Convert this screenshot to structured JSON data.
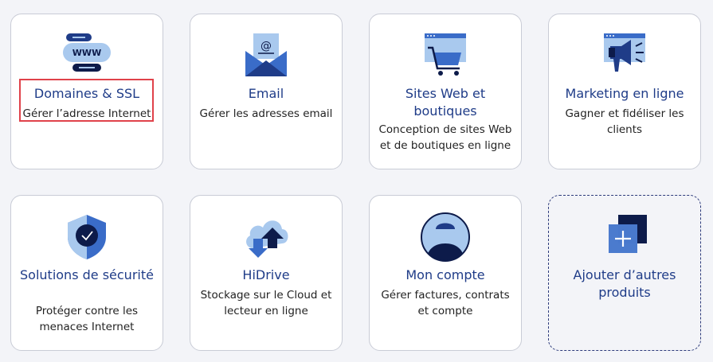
{
  "cards": [
    {
      "title": "Domaines & SSL",
      "desc": "Gérer l’adresse Internet",
      "icon": "www-icon"
    },
    {
      "title": "Email",
      "desc": "Gérer les adresses email",
      "icon": "envelope-icon"
    },
    {
      "title": "Sites Web et boutiques",
      "desc": "Conception de sites Web et de boutiques en ligne",
      "icon": "shopping-cart-icon"
    },
    {
      "title": "Marketing en ligne",
      "desc": "Gagner et fidéliser les clients",
      "icon": "megaphone-icon"
    },
    {
      "title": "Solutions de sécurité",
      "desc": "Protéger contre les menaces Internet",
      "icon": "shield-check-icon"
    },
    {
      "title": "HiDrive",
      "desc": "Stockage sur le Cloud et lecteur en ligne",
      "icon": "cloud-upload-icon"
    },
    {
      "title": "Mon compte",
      "desc": "Gérer factures, contrats et compte",
      "icon": "user-avatar-icon"
    },
    {
      "title": "Ajouter d’autres produits",
      "desc": "",
      "icon": "add-product-icon"
    }
  ],
  "colors": {
    "accent": "#1f3c88",
    "light": "#a9c9ee",
    "mid": "#3a6cc8",
    "dark": "#0d1b4a",
    "highlight": "#e0424a"
  },
  "highlighted_card": "Domaines & SSL"
}
